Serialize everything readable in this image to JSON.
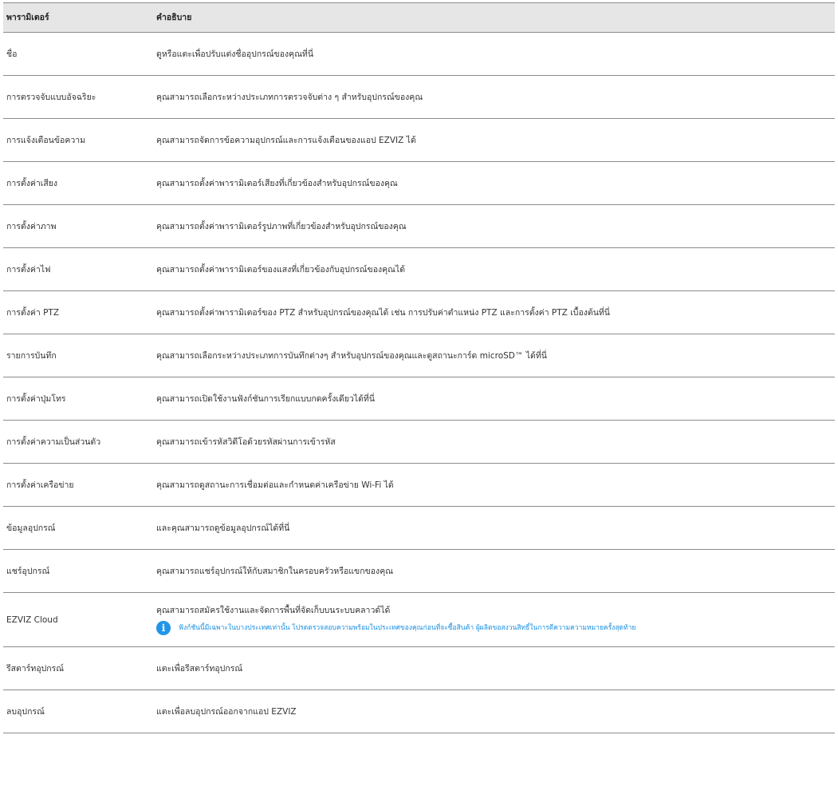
{
  "table": {
    "headers": {
      "param": "พารามิเตอร์",
      "desc": "คำอธิบาย"
    },
    "rows": [
      {
        "param": "ชื่อ",
        "desc": "ดูหรือแตะเพื่อปรับแต่งชื่ออุปกรณ์ของคุณที่นี่"
      },
      {
        "param": "การตรวจจับแบบอัจฉริยะ",
        "desc": "คุณสามารถเลือกระหว่างประเภทการตรวจจับต่าง ๆ สำหรับอุปกรณ์ของคุณ"
      },
      {
        "param": "การแจ้งเตือนข้อความ",
        "desc": "คุณสามารถจัดการข้อความอุปกรณ์และการแจ้งเตือนของแอป EZVIZ ได้"
      },
      {
        "param": "การตั้งค่าเสียง",
        "desc": "คุณสามารถตั้งค่าพารามิเตอร์เสียงที่เกี่ยวข้องสำหรับอุปกรณ์ของคุณ"
      },
      {
        "param": "การตั้งค่าภาพ",
        "desc": "คุณสามารถตั้งค่าพารามิเตอร์รูปภาพที่เกี่ยวข้องสำหรับอุปกรณ์ของคุณ"
      },
      {
        "param": "การตั้งค่าไฟ",
        "desc": "คุณสามารถตั้งค่าพารามิเตอร์ของแสงที่เกี่ยวข้องกับอุปกรณ์ของคุณได้"
      },
      {
        "param": "การตั้งค่า PTZ",
        "desc": "คุณสามารถตั้งค่าพารามิเตอร์ของ PTZ สำหรับอุปกรณ์ของคุณได้ เช่น การปรับค่าตำแหน่ง PTZ และการตั้งค่า PTZ เบื้องต้นที่นี่"
      },
      {
        "param": "รายการบันทึก",
        "desc": "คุณสามารถเลือกระหว่างประเภทการบันทึกต่างๆ สำหรับอุปกรณ์ของคุณและดูสถานะการ์ด microSD™ ได้ที่นี่"
      },
      {
        "param": "การตั้งค่าปุ่มโทร",
        "desc": "คุณสามารถเปิดใช้งานฟังก์ชันการเรียกแบบกดครั้งเดียวได้ที่นี่"
      },
      {
        "param": "การตั้งค่าความเป็นส่วนตัว",
        "desc": "คุณสามารถเข้ารหัสวิดีโอด้วยรหัสผ่านการเข้ารหัส"
      },
      {
        "param": "การตั้งค่าเครือข่าย",
        "desc": "คุณสามารถดูสถานะการเชื่อมต่อและกำหนดค่าเครือข่าย Wi-Fi ได้"
      },
      {
        "param": "ข้อมูลอุปกรณ์",
        "desc": "และคุณสามารถดูข้อมูลอุปกรณ์ได้ที่นี่"
      },
      {
        "param": "แชร์อุปกรณ์",
        "desc": "คุณสามารถแชร์อุปกรณ์ให้กับสมาชิกในครอบครัวหรือแขกของคุณ"
      }
    ],
    "cloud_row": {
      "param": "EZVIZ Cloud",
      "desc": "คุณสามารถสมัครใช้งานและจัดการพื้นที่จัดเก็บบนระบบคลาวด์ได้",
      "note_icon": "info-icon",
      "note_icon_glyph": "i",
      "note_color": "#1a8fe3",
      "note": "ฟังก์ชันนี้มีเฉพาะในบางประเทศเท่านั้น โปรดตรวจสอบความพร้อมในประเทศของคุณก่อนที่จะซื้อสินค้า ผู้ผลิตขอสงวนสิทธิ์ในการตีความความหมายครั้งสุดท้าย"
    },
    "tail_rows": [
      {
        "param": "รีสตาร์ทอุปกรณ์",
        "desc": "แตะเพื่อรีสตาร์ทอุปกรณ์"
      },
      {
        "param": "ลบอุปกรณ์",
        "desc": "แตะเพื่อลบอุปกรณ์ออกจากแอป EZVIZ"
      }
    ]
  }
}
